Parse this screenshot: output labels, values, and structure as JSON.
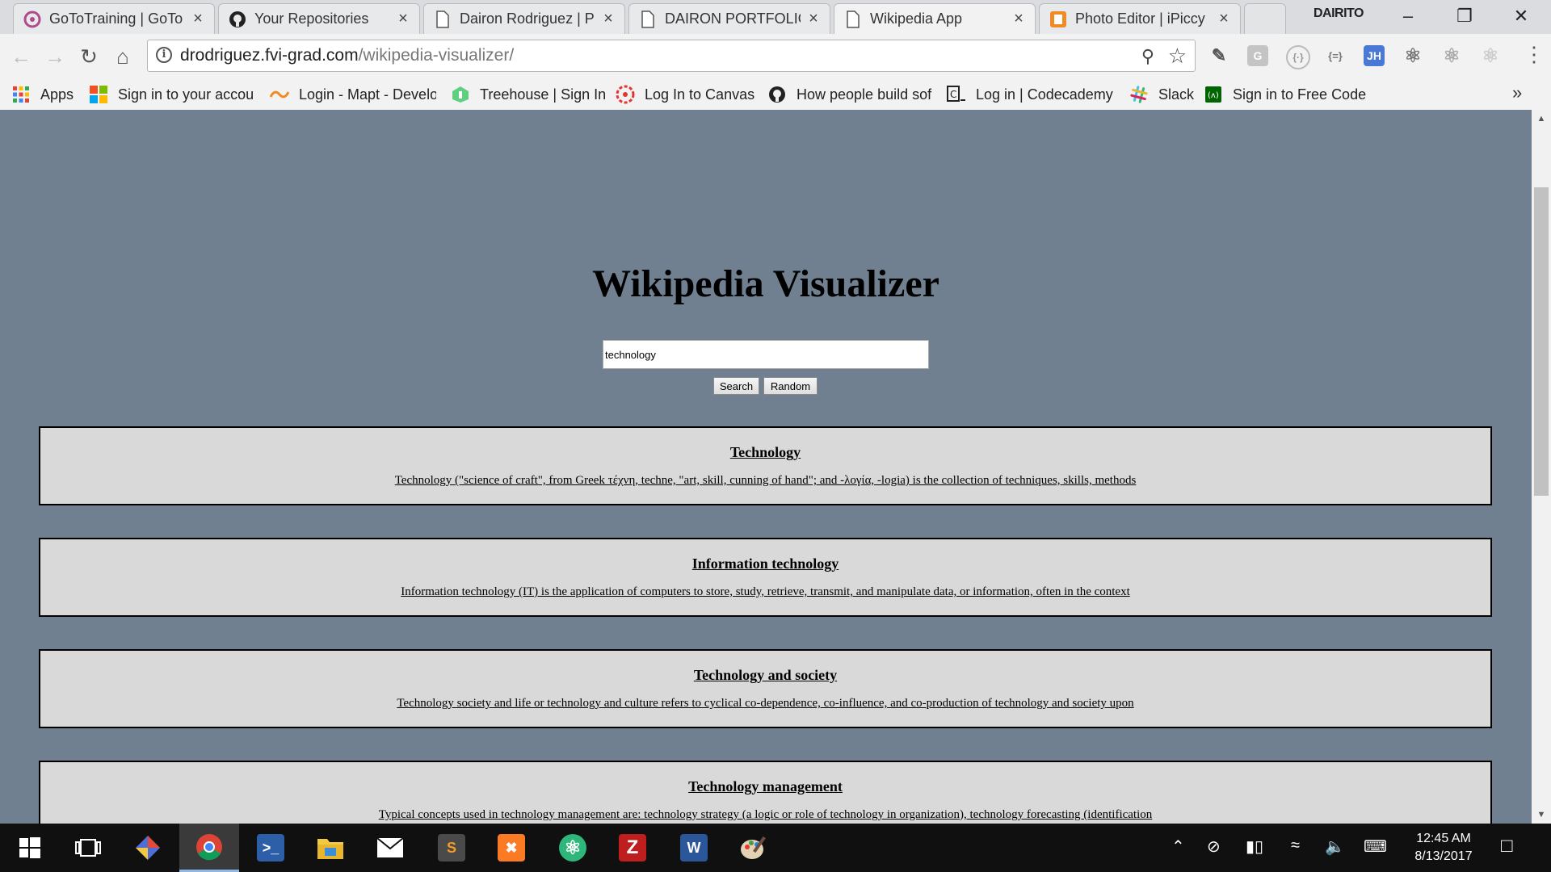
{
  "browser": {
    "tabs": [
      {
        "title": "GoToTraining | GoTo",
        "icon": "gototraining-icon",
        "active": false
      },
      {
        "title": "Your Repositories",
        "icon": "github-icon",
        "active": false
      },
      {
        "title": "Dairon Rodriguez | P",
        "icon": "page-icon",
        "active": false
      },
      {
        "title": "DAIRON PORTFOLIO",
        "icon": "page-icon",
        "active": false
      },
      {
        "title": "Wikipedia App",
        "icon": "page-icon",
        "active": true
      },
      {
        "title": "Photo Editor | iPiccy",
        "icon": "ipiccy-icon",
        "active": false
      }
    ],
    "profile_name": "DAIRITO",
    "url_host": "drodriguez.fvi-grad.com",
    "url_path": "/wikipedia-visualizer/",
    "bookmarks": [
      {
        "label": "Apps",
        "icon": "apps-grid-icon"
      },
      {
        "label": "Sign in to your accou",
        "icon": "microsoft-icon"
      },
      {
        "label": "Login - Mapt - Develo",
        "icon": "mapt-icon"
      },
      {
        "label": "Treehouse | Sign In",
        "icon": "treehouse-icon"
      },
      {
        "label": "Log In to Canvas",
        "icon": "canvas-icon"
      },
      {
        "label": "How people build sof",
        "icon": "github-icon"
      },
      {
        "label": "Log in | Codecademy",
        "icon": "codecademy-icon"
      },
      {
        "label": "Slack",
        "icon": "slack-icon"
      },
      {
        "label": "Sign in to Free Code",
        "icon": "freecodecamp-icon"
      }
    ],
    "bookmarks_more": "»",
    "extensions": [
      "color-picker-icon",
      "grammarly-icon",
      "web-developer-icon",
      "json-formatter-icon",
      "jh-icon",
      "react-devtools-icon",
      "react-devtools-gray-icon",
      "react-devtools-disabled-icon"
    ],
    "colors": {
      "tabstrip": "#dadcdf",
      "toolbar": "#f2f2f2"
    }
  },
  "page": {
    "title": "Wikipedia Visualizer",
    "search": {
      "value": "technology",
      "placeholder": ""
    },
    "buttons": {
      "search": "Search",
      "random": "Random"
    },
    "results": [
      {
        "title": "Technology",
        "snippet": "Technology (\"science of craft\", from Greek τέχνη, techne, \"art, skill, cunning of hand\"; and -λογία, -logia) is the collection of techniques, skills, methods"
      },
      {
        "title": "Information technology",
        "snippet": "Information technology (IT) is the application of computers to store, study, retrieve, transmit, and manipulate data, or information, often in the context"
      },
      {
        "title": "Technology and society",
        "snippet": "Technology society and life or technology and culture refers to cyclical co-dependence, co-influence, and co-production of technology and society upon"
      },
      {
        "title": "Technology management",
        "snippet": "Typical concepts used in technology management are: technology strategy (a logic or role of technology in organization), technology forecasting (identification"
      }
    ],
    "colors": {
      "background": "#708090",
      "result_background": "#d9d9d9",
      "border": "#000000"
    }
  },
  "taskbar": {
    "apps": [
      "start-icon",
      "task-view-icon",
      "git-kraken-icon",
      "chrome-icon",
      "powershell-icon",
      "file-explorer-icon",
      "mail-icon",
      "sublime-text-icon",
      "xampp-icon",
      "atom-icon",
      "filezilla-icon",
      "word-icon",
      "paint-icon"
    ],
    "active_app": "chrome-icon",
    "time": "12:45 AM",
    "date": "8/13/2017"
  }
}
